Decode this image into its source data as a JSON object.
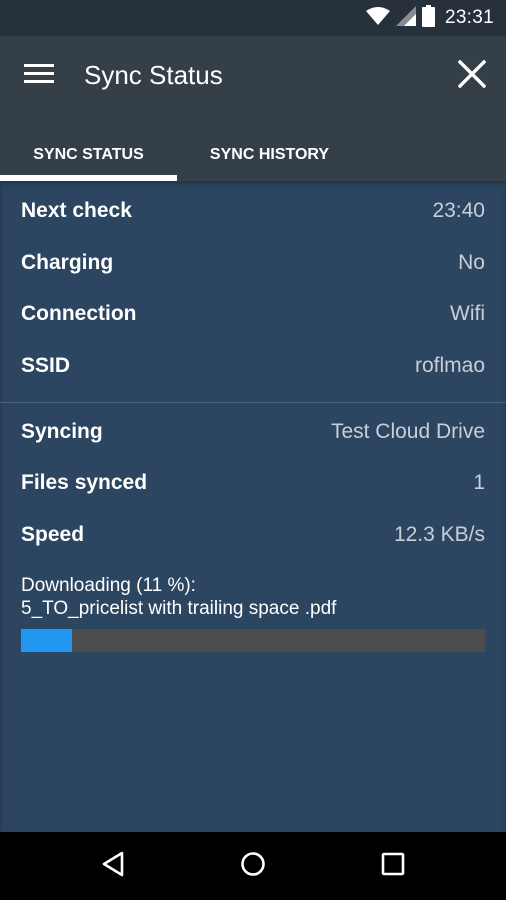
{
  "status_bar": {
    "time": "23:31",
    "icons": [
      "wifi-icon",
      "cell-signal-icon",
      "battery-icon"
    ]
  },
  "app_bar": {
    "title": "Sync Status",
    "icons": {
      "menu": "hamburger-menu-icon",
      "close": "close-icon"
    }
  },
  "tabs": [
    {
      "label": "SYNC STATUS",
      "active": true
    },
    {
      "label": "SYNC HISTORY",
      "active": false
    }
  ],
  "status": [
    {
      "label": "Next check",
      "value": "23:40"
    },
    {
      "label": "Charging",
      "value": "No"
    },
    {
      "label": "Connection",
      "value": "Wifi"
    },
    {
      "label": "SSID",
      "value": "roflmao"
    }
  ],
  "sync": [
    {
      "label": "Syncing",
      "value": "Test Cloud Drive"
    },
    {
      "label": "Files synced",
      "value": "1"
    },
    {
      "label": "Speed",
      "value": "12.3 KB/s"
    }
  ],
  "download": {
    "line1": "Downloading (11 %):",
    "line2": "5_TO_pricelist with trailing space .pdf",
    "progress": 0.11
  },
  "nav_bar": {
    "icons": [
      "back-triangle-icon",
      "home-circle-icon",
      "recents-square-icon"
    ]
  },
  "colors": {
    "content_bg": "#2c4560",
    "app_bar_bg": "#343f48",
    "status_bar_bg": "#26313b",
    "progress_fill": "#2196f3",
    "progress_track": "#4d4d4d",
    "value_text": "#c7cfd8"
  }
}
